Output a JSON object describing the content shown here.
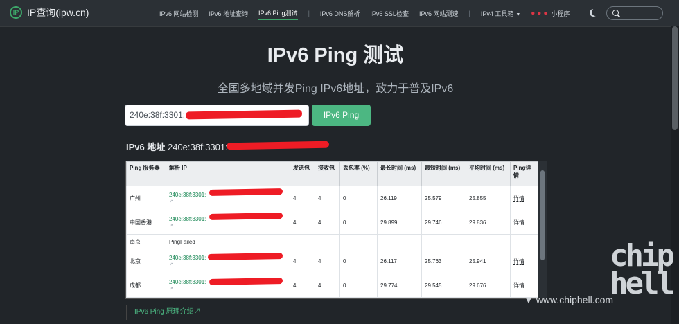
{
  "brand": {
    "logo_text": "IP",
    "name": "IP查询(ipw.cn)"
  },
  "nav": {
    "items": [
      "IPv6 网站检测",
      "IPv6 地址查询",
      "IPv6 Ping测试"
    ],
    "items2": [
      "IPv6 DNS解析",
      "IPv6 SSL检查",
      "IPv6 网站测速"
    ],
    "tools": "IPv4 工具箱",
    "drops": "🌢🌢🌢",
    "mini": "小程序",
    "active": "IPv6 Ping测试"
  },
  "page": {
    "title": "IPv6 Ping 测试",
    "subtitle": "全国多地域并发Ping IPv6地址，致力于普及IPv6",
    "input_value": "240e:38f:3301:",
    "ping_button": "IPv6 Ping",
    "addr_label": "IPv6 地址",
    "addr_value": "240e:38f:3301:"
  },
  "table": {
    "headers": [
      "Ping 服务器",
      "解析 IP",
      "发送包",
      "接收包",
      "丢包率 (%)",
      "最长时间 (ms)",
      "最短时间 (ms)",
      "平均时间 (ms)",
      "Ping详情"
    ],
    "rows": [
      {
        "server": "广州",
        "ip": "240e:38f:3301:",
        "sent": "4",
        "recv": "4",
        "loss": "0",
        "max": "26.119",
        "min": "25.579",
        "avg": "25.855",
        "detail": "详情"
      },
      {
        "server": "中国香港",
        "ip": "240e:38f:3301:",
        "sent": "4",
        "recv": "4",
        "loss": "0",
        "max": "29.899",
        "min": "29.746",
        "avg": "29.836",
        "detail": "详情"
      },
      {
        "server": "南京",
        "ip": "PingFailed",
        "sent": "",
        "recv": "",
        "loss": "",
        "max": "",
        "min": "",
        "avg": "",
        "detail": ""
      },
      {
        "server": "北京",
        "ip": "240e:38f:3301:",
        "sent": "4",
        "recv": "4",
        "loss": "0",
        "max": "26.117",
        "min": "25.763",
        "avg": "25.941",
        "detail": "详情"
      },
      {
        "server": "成都",
        "ip": "240e:38f:3301:",
        "sent": "4",
        "recv": "4",
        "loss": "0",
        "max": "29.774",
        "min": "29.545",
        "avg": "29.676",
        "detail": "详情"
      }
    ]
  },
  "footer": {
    "part1": "IPv6 Ping",
    "part2": " 原理介绍"
  },
  "watermark": {
    "url": "www.chiphell.com",
    "logo": "chip\nhell"
  },
  "colors": {
    "accent": "#4cb782",
    "background": "#212529",
    "redaction": "#ee1c25"
  }
}
